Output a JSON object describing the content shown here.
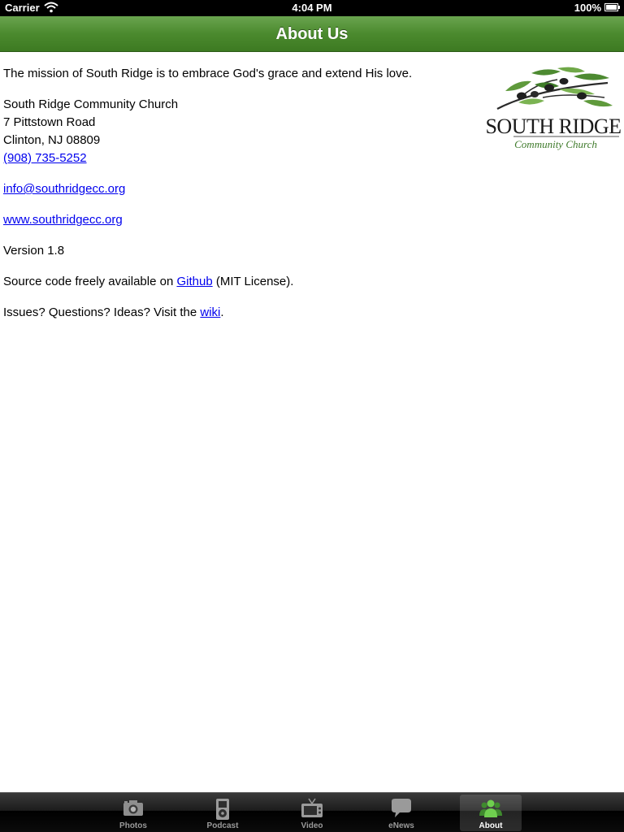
{
  "status_bar": {
    "carrier": "Carrier",
    "time": "4:04 PM",
    "battery": "100%"
  },
  "nav": {
    "title": "About Us"
  },
  "content": {
    "mission": "The mission of South Ridge is to embrace God's grace and extend His love.",
    "church_name": "South Ridge Community Church",
    "street": "7 Pittstown Road",
    "city": "Clinton, NJ 08809",
    "phone": "(908) 735-5252",
    "email": "info@southridgecc.org",
    "website": "www.southridgecc.org",
    "version": "Version 1.8",
    "source_prefix": "Source code freely available on ",
    "source_link": "Github",
    "source_suffix": " (MIT License).",
    "issues_prefix": "Issues? Questions? Ideas? Visit the ",
    "issues_link": "wiki",
    "issues_suffix": "."
  },
  "logo": {
    "line1": "SOUTH RIDGE",
    "line2": "Community Church"
  },
  "tabs": [
    {
      "label": "Photos",
      "icon": "camera-icon",
      "selected": false
    },
    {
      "label": "Podcast",
      "icon": "ipod-icon",
      "selected": false
    },
    {
      "label": "Video",
      "icon": "tv-icon",
      "selected": false
    },
    {
      "label": "eNews",
      "icon": "speech-bubble-icon",
      "selected": false
    },
    {
      "label": "About",
      "icon": "people-icon",
      "selected": true
    }
  ],
  "colors": {
    "nav_green": "#4b8a2e",
    "link_blue": "#0000ee",
    "logo_green": "#3e7a2a"
  }
}
